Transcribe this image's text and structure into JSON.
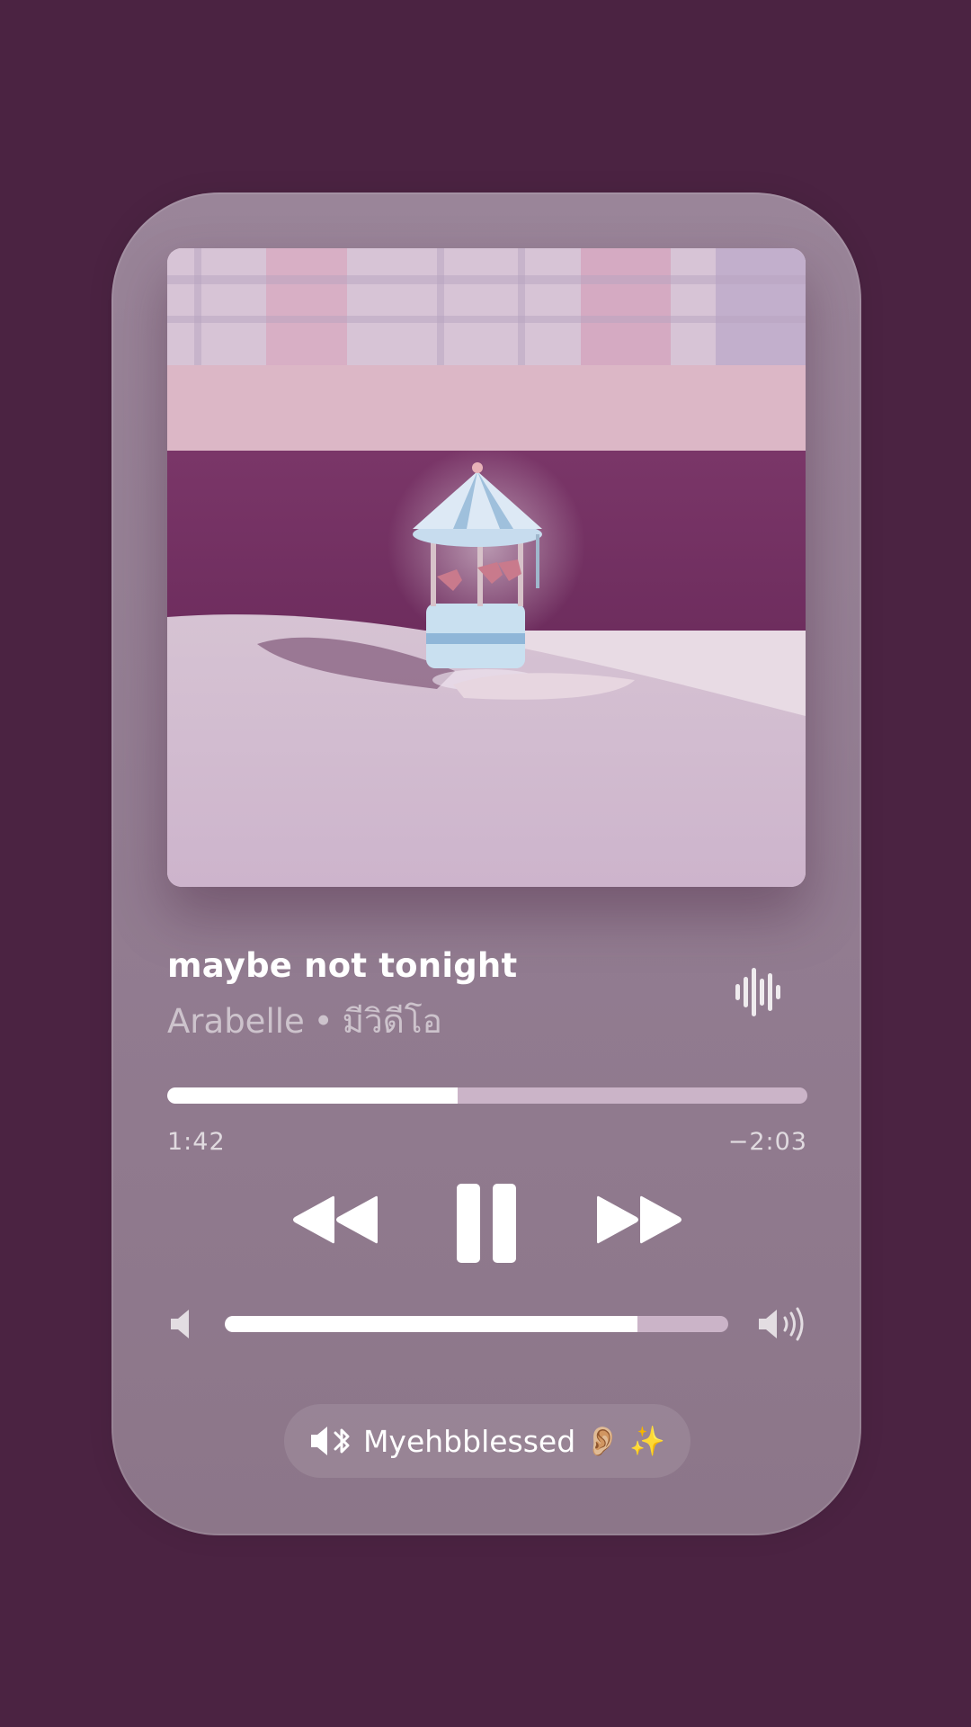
{
  "player": {
    "track_title": "maybe not tonight",
    "artist": "Arabelle",
    "separator": "•",
    "album": "มีวิดีโอ",
    "time_elapsed": "1:42",
    "time_remaining": "−2:03",
    "progress_fraction": 0.453,
    "volume_fraction": 0.82,
    "device_name": "Myehbblessed",
    "device_emoji": "👂🏼 ✨"
  },
  "colors": {
    "background": "#4b2342",
    "card": "#937d92",
    "track_bg": "#cbb4c8",
    "fill": "#ffffff"
  },
  "icons": {
    "artwork": "carousel-music-box-artwork",
    "wave": "audio-waveform-icon",
    "rewind": "rewind-icon",
    "pause": "pause-icon",
    "forward": "fast-forward-icon",
    "vol_low": "speaker-low-icon",
    "vol_high": "speaker-high-icon",
    "device": "bluetooth-speaker-icon"
  }
}
